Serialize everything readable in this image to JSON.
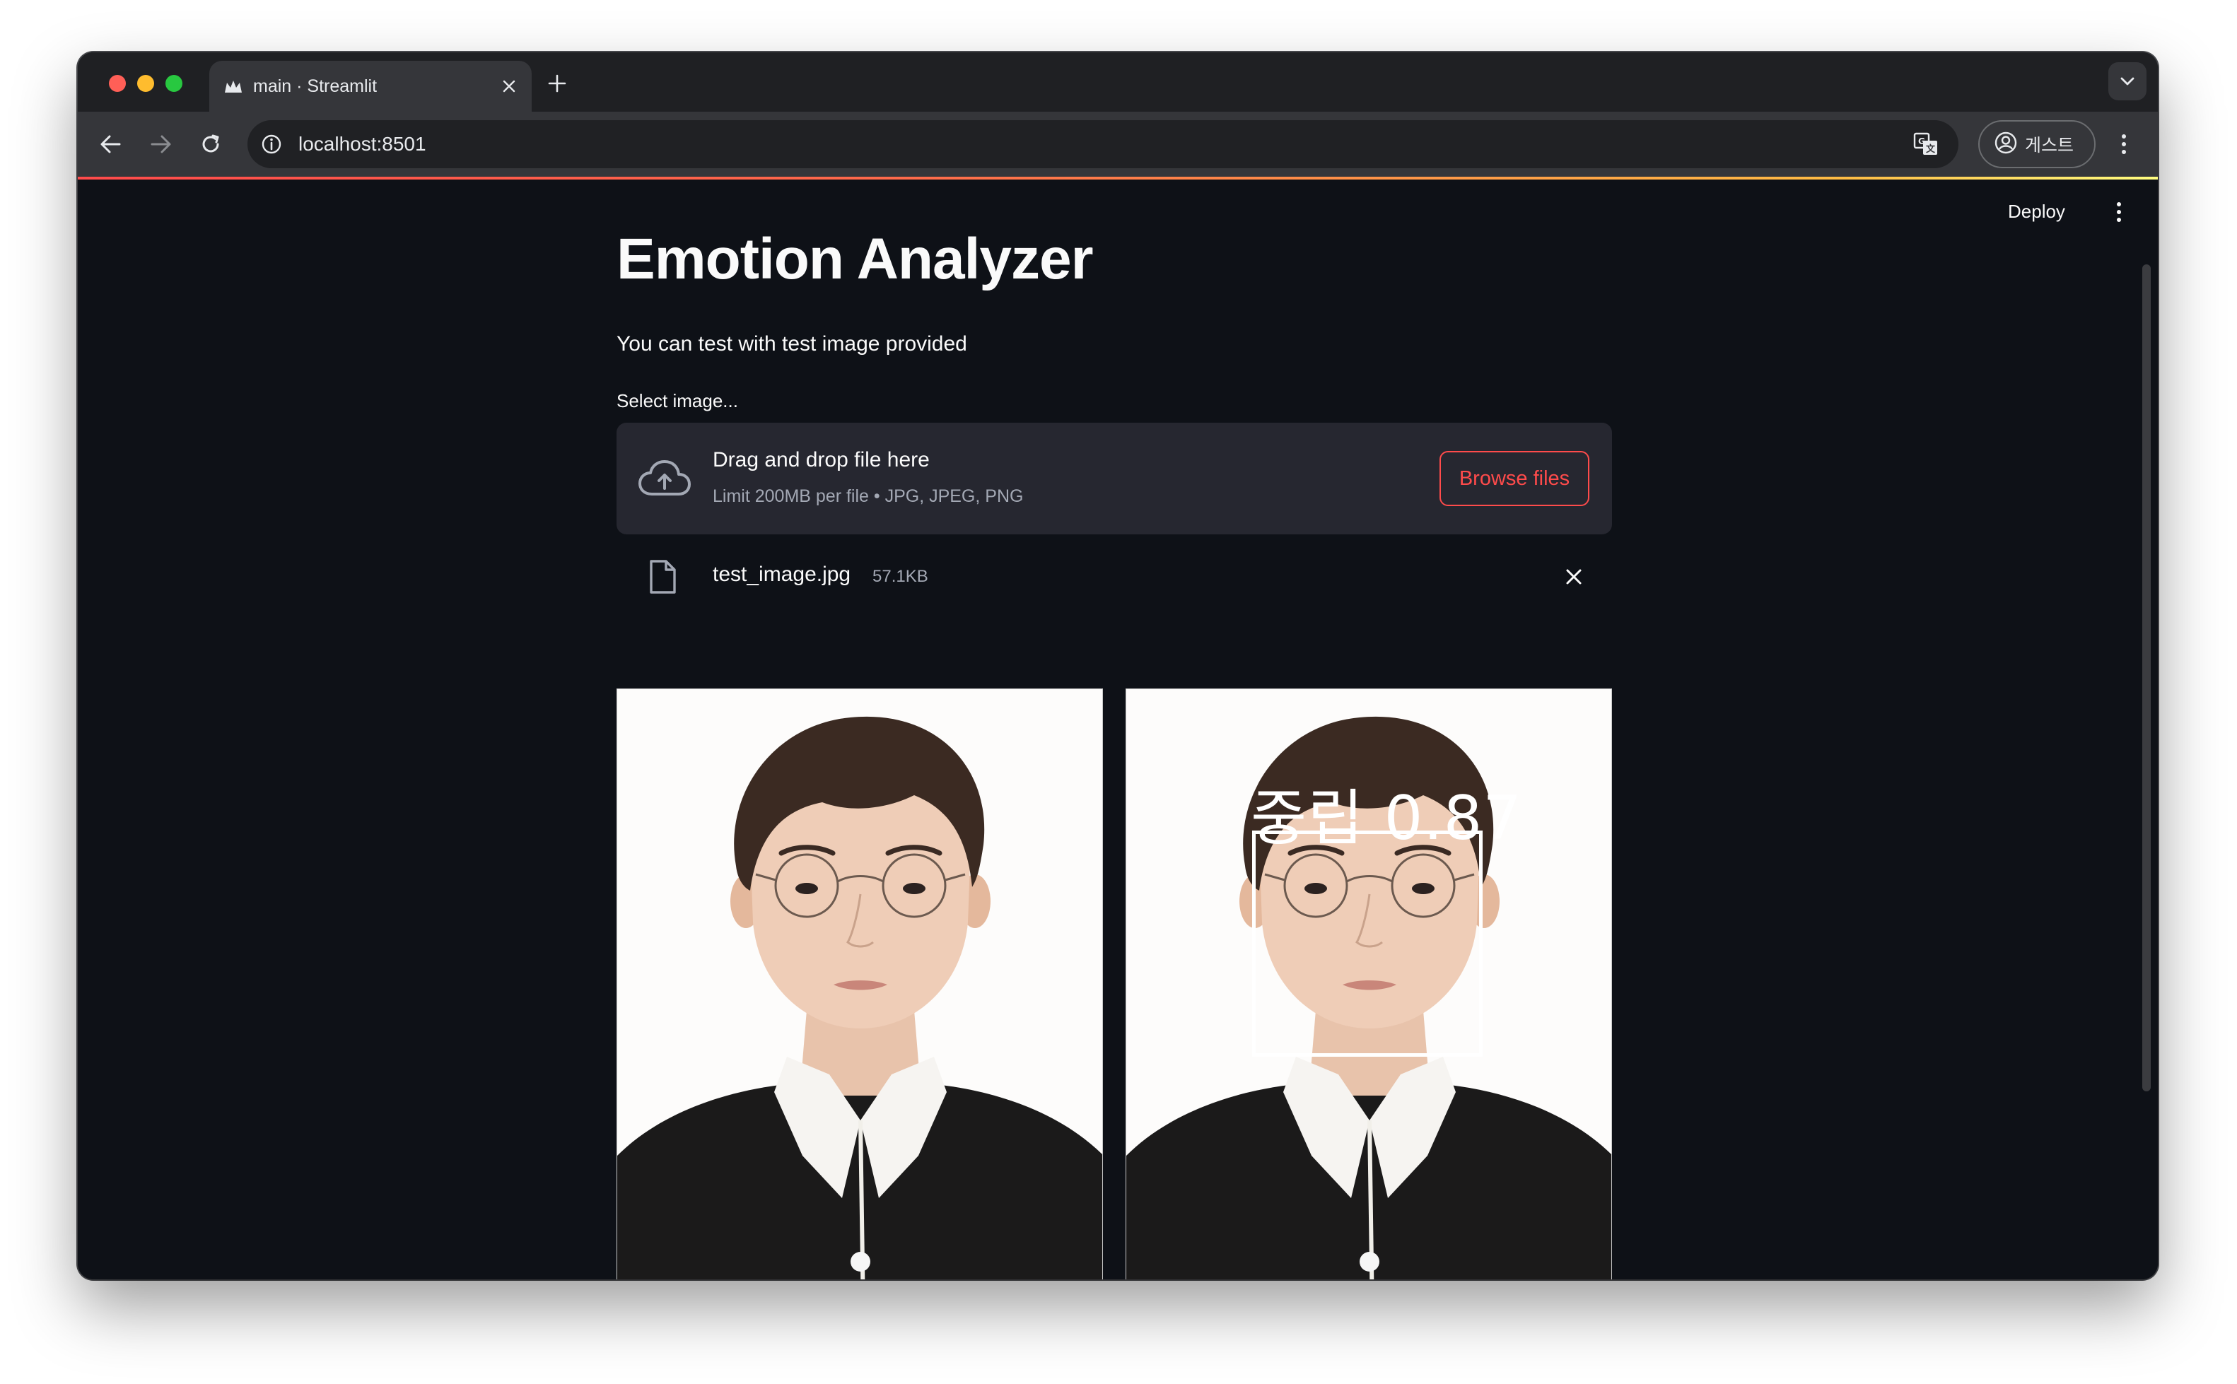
{
  "browser": {
    "tab_title": "main · Streamlit",
    "url": "localhost:8501",
    "profile_label": "게스트"
  },
  "header": {
    "deploy_label": "Deploy"
  },
  "main": {
    "title": "Emotion Analyzer",
    "subtitle": "You can test with test image provided",
    "uploader": {
      "label": "Select image...",
      "title": "Drag and drop file here",
      "hint": "Limit 200MB per file • JPG, JPEG, PNG",
      "browse_label": "Browse files"
    },
    "file": {
      "name": "test_image.jpg",
      "size": "57.1KB"
    },
    "result": {
      "emotion_label": "중립 0.87"
    }
  },
  "colors": {
    "app_bg": "#0e1117",
    "accent": "#ff4b4b",
    "dropzone_bg": "#262730",
    "browser_toolbar": "#35363a"
  },
  "icons": [
    "streamlit-favicon-icon",
    "close-icon",
    "plus-icon",
    "chevron-down-icon",
    "back-arrow-icon",
    "forward-arrow-icon",
    "reload-icon",
    "info-icon",
    "translate-icon",
    "profile-icon",
    "more-vert-icon",
    "cloud-upload-icon",
    "file-icon"
  ]
}
